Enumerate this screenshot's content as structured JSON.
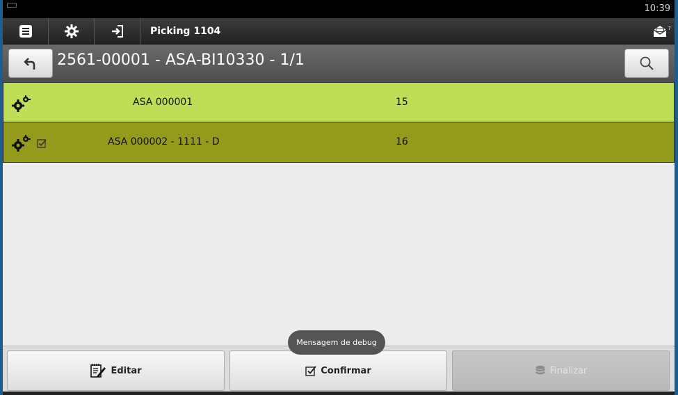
{
  "statusbar": {
    "time": "10:39"
  },
  "appbar": {
    "title": "Picking 1104",
    "mail_badge": "7",
    "icons": [
      "list-icon",
      "gear-icon",
      "login-icon",
      "mail-icon"
    ]
  },
  "header": {
    "document": "2561-00001 - ASA-BI10330 - 1/1"
  },
  "rows": [
    {
      "code": "ASA 000001",
      "qty": "15",
      "checked": false,
      "color": "#bede58"
    },
    {
      "code": "ASA 000002 - 1111 - D",
      "qty": "16",
      "checked": true,
      "color": "#939a1c"
    }
  ],
  "toast": "Mensagem de debug",
  "buttons": {
    "edit": "Editar",
    "confirm": "Confirmar",
    "finish": "Finalizar"
  }
}
